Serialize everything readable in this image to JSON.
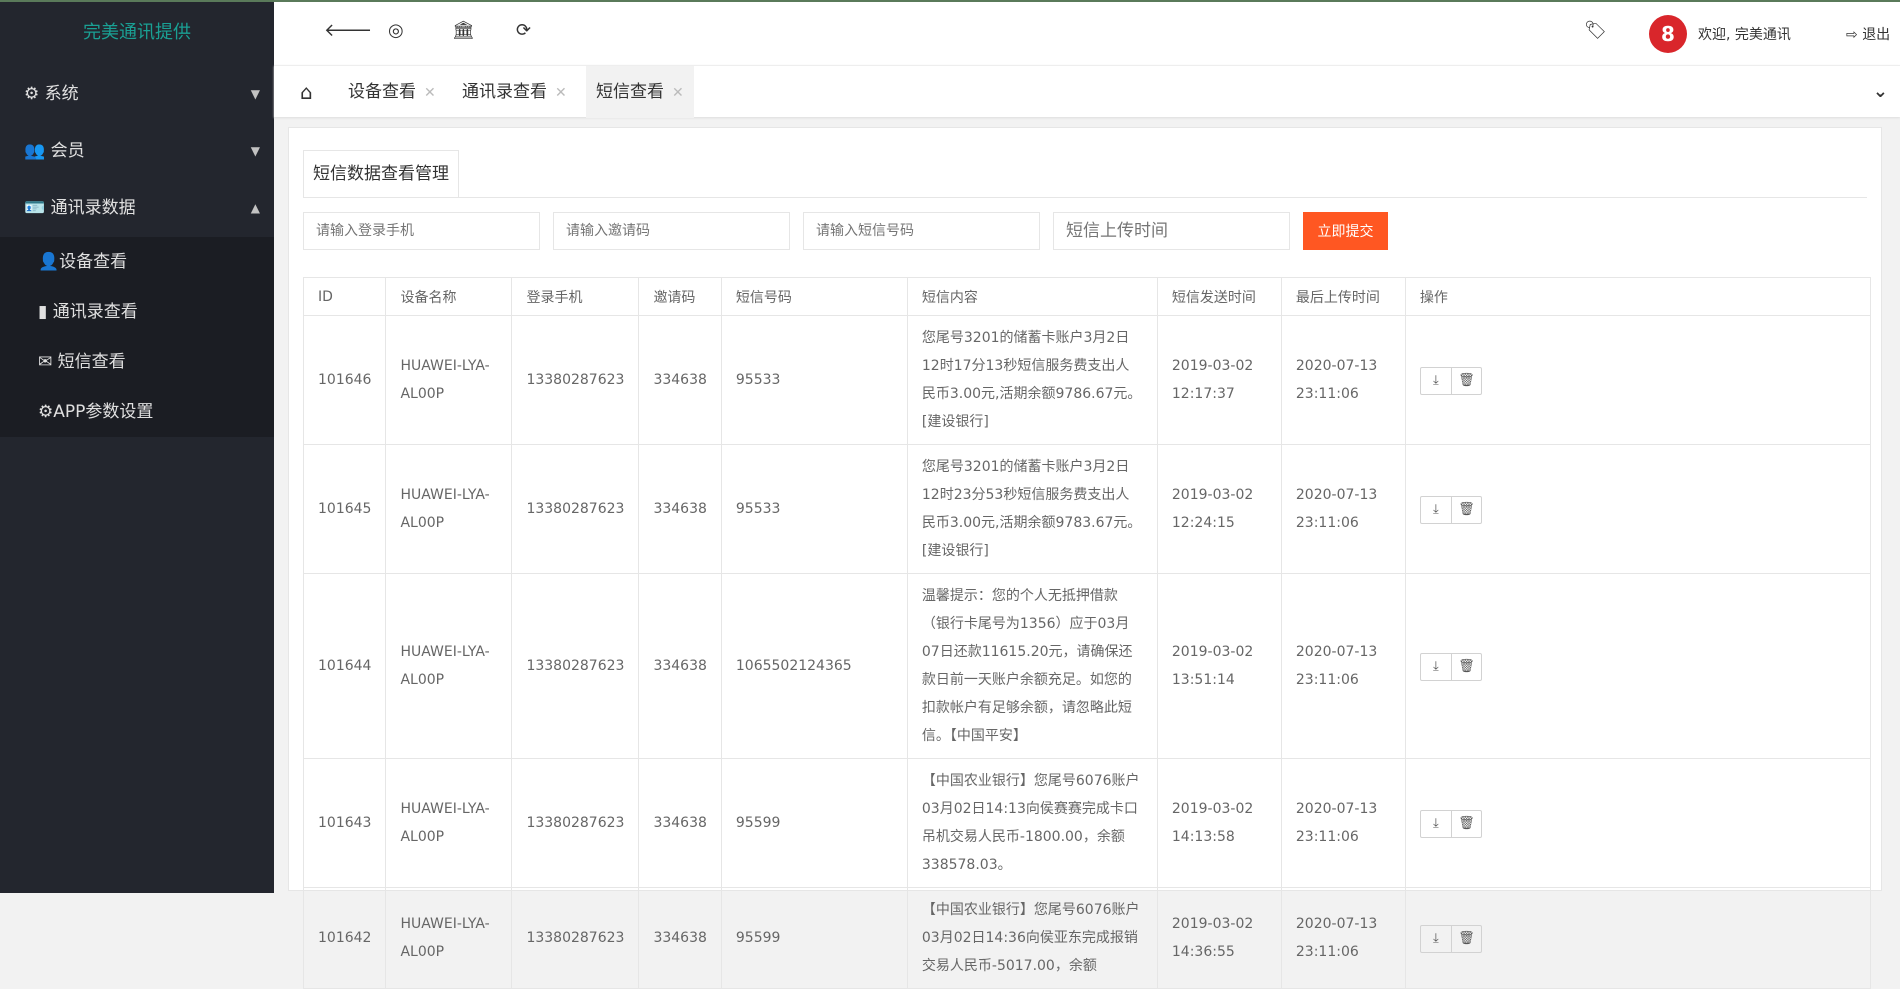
{
  "brand": "完美通讯提供",
  "sidebar": {
    "menus": [
      {
        "label": "系统",
        "icon": "gear-icon"
      },
      {
        "label": "会员",
        "icon": "users-icon"
      },
      {
        "label": "通讯录数据",
        "icon": "id-card-icon"
      }
    ],
    "sub": [
      {
        "label": "设备查看",
        "icon": "user-icon"
      },
      {
        "label": "通讯录查看",
        "icon": "phone-book-icon"
      },
      {
        "label": "短信查看",
        "icon": "envelope-icon"
      },
      {
        "label": "APP参数设置",
        "icon": "gear-icon"
      }
    ]
  },
  "topbar": {
    "welcome": "欢迎, 完美通讯",
    "logout": "退出"
  },
  "tabs": [
    {
      "label": "设备查看"
    },
    {
      "label": "通讯录查看"
    },
    {
      "label": "短信查看"
    }
  ],
  "panel": {
    "title": "短信数据查看管理"
  },
  "filters": {
    "phone": "请输入登录手机",
    "invite": "请输入邀请码",
    "sms": "请输入短信号码",
    "time": "短信上传时间",
    "submit": "立即提交"
  },
  "table": {
    "headers": [
      "ID",
      "设备名称",
      "登录手机",
      "邀请码",
      "短信号码",
      "短信内容",
      "短信发送时间",
      "最后上传时间",
      "操作"
    ],
    "rows": [
      [
        "101646",
        "HUAWEI-LYA-AL00P",
        "13380287623",
        "334638",
        "95533",
        "您尾号3201的储蓄卡账户3月2日12时17分13秒短信服务费支出人民币3.00元,活期余额9786.67元。[建设银行]",
        "2019-03-02 12:17:37",
        "2020-07-13 23:11:06"
      ],
      [
        "101645",
        "HUAWEI-LYA-AL00P",
        "13380287623",
        "334638",
        "95533",
        "您尾号3201的储蓄卡账户3月2日12时23分53秒短信服务费支出人民币3.00元,活期余额9783.67元。[建设银行]",
        "2019-03-02 12:24:15",
        "2020-07-13 23:11:06"
      ],
      [
        "101644",
        "HUAWEI-LYA-AL00P",
        "13380287623",
        "334638",
        "1065502124365",
        "温馨提示：您的个人无抵押借款（银行卡尾号为1356）应于03月07日还款11615.20元，请确保还款日前一天账户余额充足。如您的扣款帐户有足够余额，请忽略此短信。【中国平安】",
        "2019-03-02 13:51:14",
        "2020-07-13 23:11:06"
      ],
      [
        "101643",
        "HUAWEI-LYA-AL00P",
        "13380287623",
        "334638",
        "95599",
        "【中国农业银行】您尾号6076账户03月02日14:13向侯赛赛完成卡口吊机交易人民币-1800.00，余额338578.03。",
        "2019-03-02 14:13:58",
        "2020-07-13 23:11:06"
      ],
      [
        "101642",
        "HUAWEI-LYA-AL00P",
        "13380287623",
        "334638",
        "95599",
        "【中国农业银行】您尾号6076账户03月02日14:36向侯亚东完成报销交易人民币-5017.00，余额",
        "2019-03-02 14:36:55",
        "2020-07-13 23:11:06"
      ]
    ]
  }
}
